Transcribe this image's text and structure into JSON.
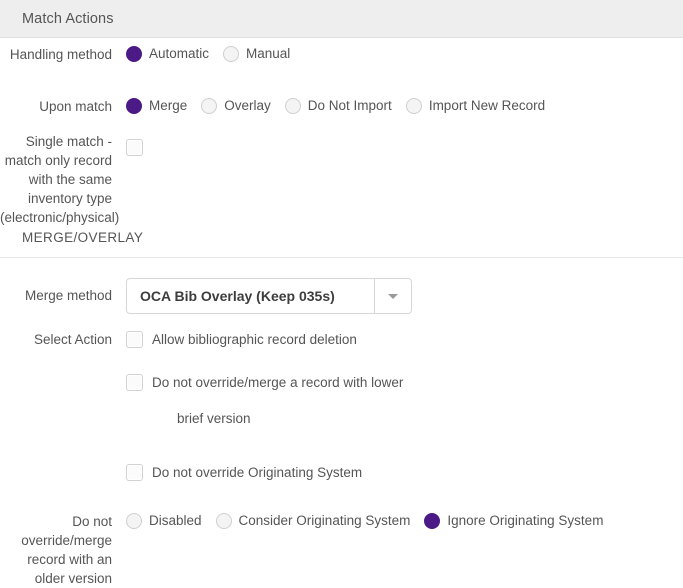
{
  "panel": {
    "title": "Match Actions"
  },
  "handling_method": {
    "label": "Handling method",
    "options": [
      {
        "label": "Automatic",
        "selected": true
      },
      {
        "label": "Manual",
        "selected": false
      }
    ]
  },
  "upon_match": {
    "label": "Upon match",
    "options": [
      {
        "label": "Merge",
        "selected": true
      },
      {
        "label": "Overlay",
        "selected": false
      },
      {
        "label": "Do Not Import",
        "selected": false
      },
      {
        "label": "Import New Record",
        "selected": false
      }
    ]
  },
  "single_match": {
    "label": "Single match - match only record with the same inventory type (electronic/physical)",
    "checked": false
  },
  "merge_overlay_section": {
    "heading": "MERGE/OVERLAY"
  },
  "merge_method": {
    "label": "Merge method",
    "value": "OCA Bib Overlay (Keep 035s)",
    "caret_icon": "chevron-down-icon"
  },
  "select_action": {
    "label": "Select Action",
    "checkboxes": [
      {
        "label": "Allow bibliographic record deletion",
        "checked": false
      },
      {
        "label": "Do not override/merge a record with lower",
        "checked": false,
        "continuation": "brief version"
      },
      {
        "label": "Do not override Originating System",
        "checked": false
      }
    ]
  },
  "older_version": {
    "label": "Do not override/merge record with an older version",
    "options": [
      {
        "label": "Disabled",
        "selected": false
      },
      {
        "label": "Consider Originating System",
        "selected": false
      },
      {
        "label": "Ignore Originating System",
        "selected": true
      }
    ]
  },
  "colors": {
    "accent_purple": "#4b1a87",
    "header_bg": "#eeeeee",
    "text_gray": "#555555",
    "border_gray": "#d8d8d8"
  }
}
